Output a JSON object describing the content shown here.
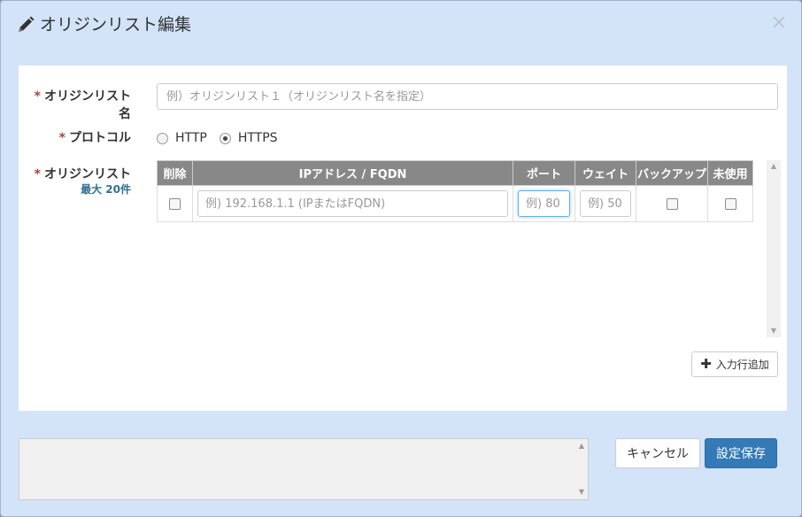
{
  "dialog": {
    "title": "オリジンリスト編集",
    "close_symbol": "×"
  },
  "form": {
    "origin_list_name": {
      "required_mark": "*",
      "label": "オリジンリスト名",
      "value": "",
      "placeholder": "例）オリジンリスト１（オリジンリスト名を指定）"
    },
    "protocol": {
      "required_mark": "*",
      "label": "プロトコル",
      "options": [
        {
          "label": "HTTP",
          "checked": false
        },
        {
          "label": "HTTPS",
          "checked": true
        }
      ]
    },
    "origin_list": {
      "required_mark": "*",
      "label": "オリジンリスト",
      "sub_label": "最大 20件",
      "columns": [
        "削除",
        "IPアドレス / FQDN",
        "ポート",
        "ウェイト",
        "バックアップ",
        "未使用"
      ],
      "rows": [
        {
          "delete_checked": false,
          "address_placeholder": "例) 192.168.1.1 (IPまたはFQDN)",
          "port_placeholder": "例) 80",
          "weight_placeholder": "例) 50",
          "backup_checked": false,
          "unused_checked": false
        }
      ]
    },
    "add_row_label": "入力行追加"
  },
  "footer": {
    "message": "",
    "cancel_label": "キャンセル",
    "save_label": "設定保存"
  },
  "colors": {
    "dialog_bg": "#d3e3f8",
    "primary": "#337ab7",
    "table_header": "#888888",
    "required": "#a94442",
    "sublabel": "#31708f"
  }
}
